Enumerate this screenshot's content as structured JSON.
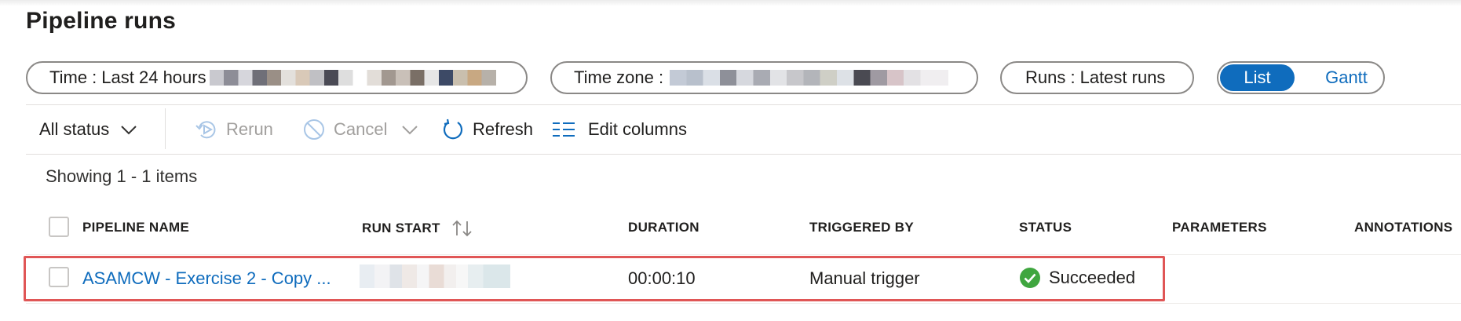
{
  "page": {
    "title": "Pipeline runs"
  },
  "filters": {
    "time_label": "Time :",
    "time_value": "Last 24 hours",
    "timezone_label": "Time zone :",
    "runs_label": "Runs :",
    "runs_value": "Latest runs"
  },
  "view_toggle": {
    "list": "List",
    "gantt": "Gantt",
    "selected": "List"
  },
  "toolbar": {
    "status_filter": "All status",
    "rerun": "Rerun",
    "cancel": "Cancel",
    "refresh": "Refresh",
    "edit_columns": "Edit columns"
  },
  "summary": {
    "showing": "Showing 1 - 1 items"
  },
  "table": {
    "columns": [
      "PIPELINE NAME",
      "RUN START",
      "DURATION",
      "TRIGGERED BY",
      "STATUS",
      "PARAMETERS",
      "ANNOTATIONS"
    ],
    "rows": [
      {
        "pipeline_name": "ASAMCW - Exercise 2 - Copy ...",
        "duration": "00:00:10",
        "triggered_by": "Manual trigger",
        "status": "Succeeded"
      }
    ]
  },
  "colors": {
    "accent": "#0f6cbd",
    "success": "#3fa63f",
    "highlight": "#e05656"
  }
}
